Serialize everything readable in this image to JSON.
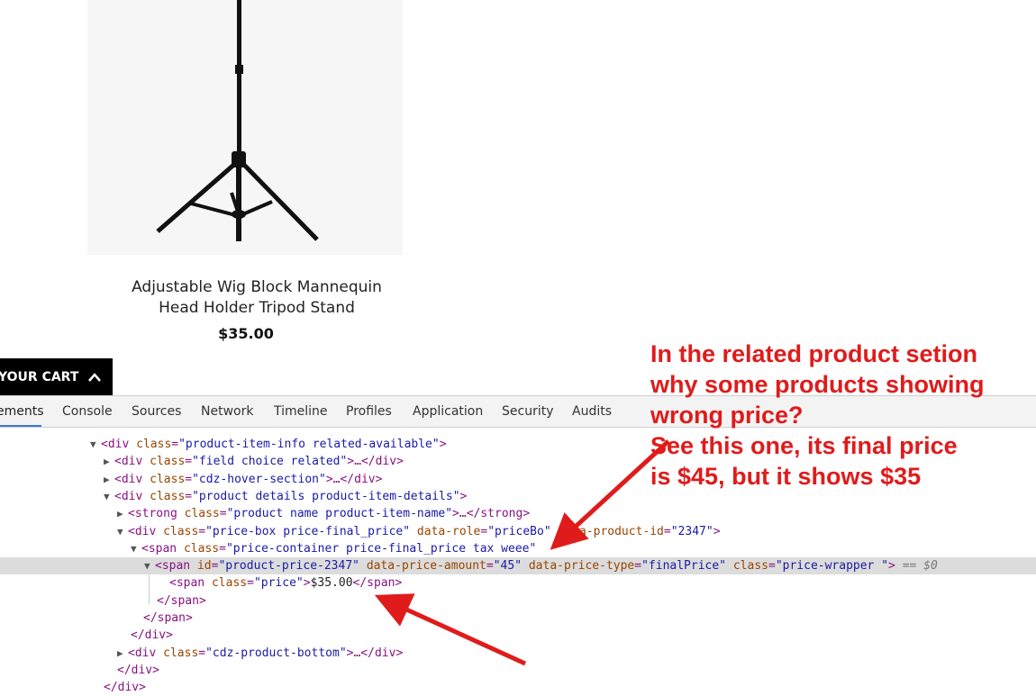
{
  "product": {
    "name_line1": "Adjustable Wig Block Mannequin",
    "name_line2": "Head Holder Tripod Stand",
    "price": "$35.00",
    "image_icon": "tripod-stand-image"
  },
  "cart_button": {
    "label": "YOUR CART",
    "icon": "chevron-up-icon"
  },
  "devtools": {
    "tabs": [
      "ements",
      "Console",
      "Sources",
      "Network",
      "Timeline",
      "Profiles",
      "Application",
      "Security",
      "Audits"
    ],
    "active_tab": "ements",
    "rows": [
      {
        "tag_open": "<div",
        "attrs": [
          [
            "class",
            "product-item-info related-available"
          ]
        ],
        "close": ">"
      },
      {
        "tag_open": "<div",
        "attrs": [
          [
            "class",
            "field choice related"
          ]
        ],
        "close": ">…</div>"
      },
      {
        "tag_open": "<div",
        "attrs": [
          [
            "class",
            "cdz-hover-section"
          ]
        ],
        "close": ">…</div>"
      },
      {
        "tag_open": "<div",
        "attrs": [
          [
            "class",
            "product details product-item-details"
          ]
        ],
        "close": ">"
      },
      {
        "tag_open": "<strong",
        "attrs": [
          [
            "class",
            "product name product-item-name"
          ]
        ],
        "close": ">…</strong>"
      },
      {
        "tag_open": "<div",
        "attrs": [
          [
            "class",
            "price-box price-final_price"
          ],
          [
            "data-role",
            "priceBo"
          ],
          [
            "data-product-id",
            "2347"
          ]
        ],
        "close": ">"
      },
      {
        "tag_open": "<span",
        "attrs": [
          [
            "class",
            "price-container price-final_price tax weee"
          ]
        ],
        "close": ""
      },
      {
        "tag_open": "<span",
        "attrs": [
          [
            "id",
            "product-price-2347"
          ],
          [
            "data-price-amount",
            "45"
          ],
          [
            "data-price-type",
            "finalPrice"
          ],
          [
            "class",
            "price-wrapper "
          ]
        ],
        "close": ">",
        "eq": "== $0"
      },
      {
        "tag_open": "<span",
        "attrs": [
          [
            "class",
            "price"
          ]
        ],
        "close": ">",
        "text": "$35.00",
        "end": "</span>"
      },
      {
        "close_only": "</span>"
      },
      {
        "close_only": "</span>"
      },
      {
        "close_only": "</div>"
      },
      {
        "tag_open": "<div",
        "attrs": [
          [
            "class",
            "cdz-product-bottom"
          ]
        ],
        "close": ">…</div>"
      },
      {
        "close_only": "</div>"
      },
      {
        "close_only": "</div>"
      }
    ]
  },
  "annotation": {
    "lines": [
      "In the related product setion",
      "why some products showing",
      "wrong price?",
      "See this one, its final price",
      "is $45, but it shows $35"
    ],
    "color": "#e01b1b"
  }
}
